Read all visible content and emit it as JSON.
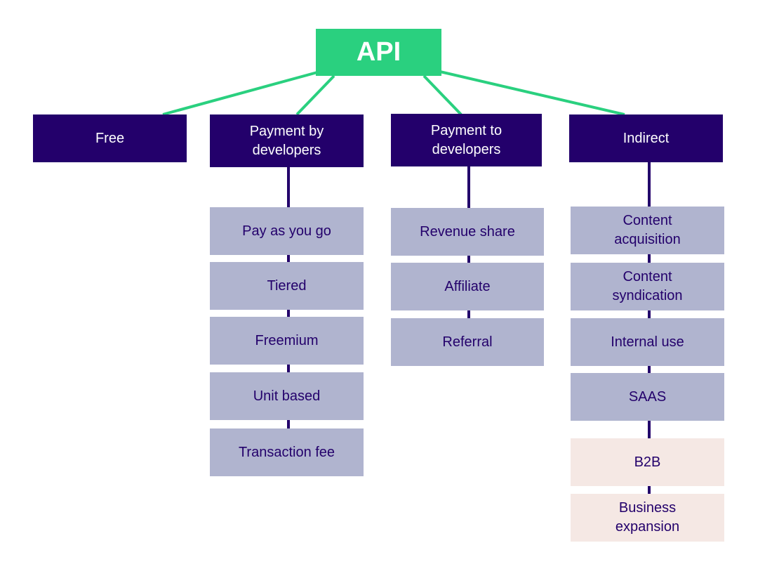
{
  "colors": {
    "root": "#2ad07f",
    "category": "#23006b",
    "model": "#b0b4cf",
    "highlight": "#f5e8e4"
  },
  "root": {
    "label": "API"
  },
  "categories": [
    {
      "label": "Free",
      "children": []
    },
    {
      "label": "Payment by developers",
      "children": [
        "Pay as you go",
        "Tiered",
        "Freemium",
        "Unit based",
        "Transaction fee"
      ]
    },
    {
      "label": "Payment to developers",
      "children": [
        "Revenue share",
        "Affiliate",
        "Referral"
      ]
    },
    {
      "label": "Indirect",
      "children": [
        "Content acquisition",
        "Content syndication",
        "Internal use",
        "SAAS",
        "B2B",
        "Business expansion"
      ]
    }
  ]
}
